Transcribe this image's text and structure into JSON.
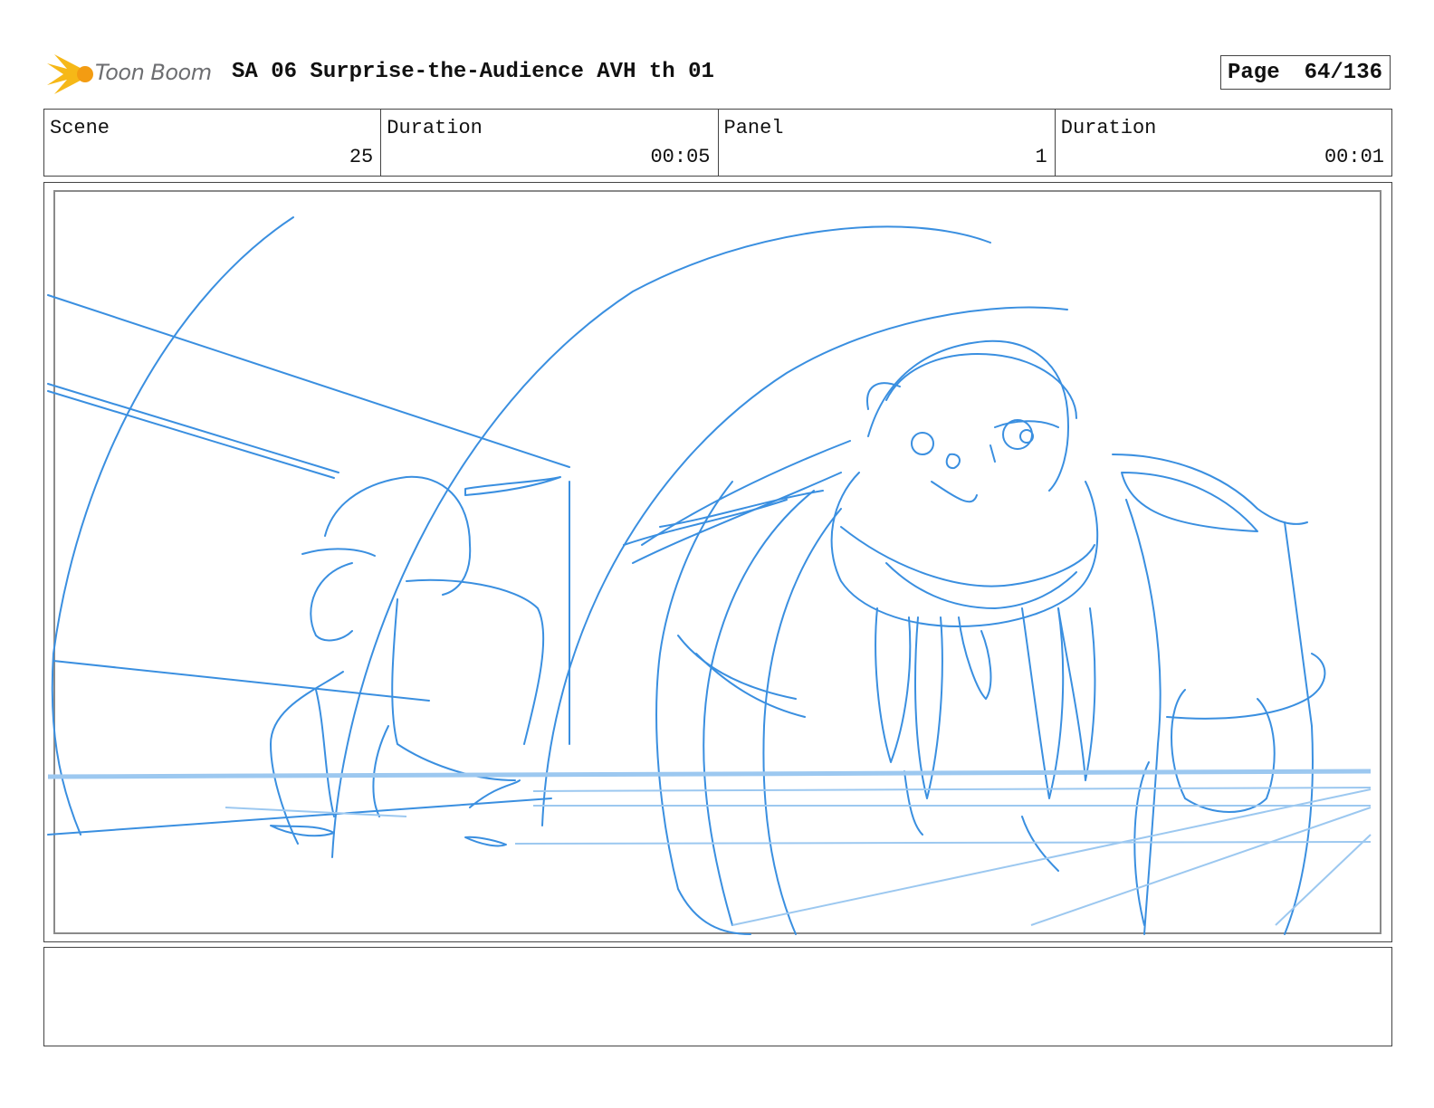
{
  "header": {
    "logo_text": "Toon Boom",
    "title": "SA 06 Surprise-the-Audience AVH th 01",
    "page_label": "Page",
    "page_value": "64/136"
  },
  "info": [
    {
      "label": "Scene",
      "value": "25"
    },
    {
      "label": "Duration",
      "value": "00:05"
    },
    {
      "label": "Panel",
      "value": "1"
    },
    {
      "label": "Duration",
      "value": "00:01"
    }
  ],
  "panel": {
    "sketch_icon": "storyboard-sketch-walrus",
    "stroke_color": "#3a8fe0",
    "guide_color": "#9cc8f0"
  },
  "notes": {
    "text": ""
  }
}
